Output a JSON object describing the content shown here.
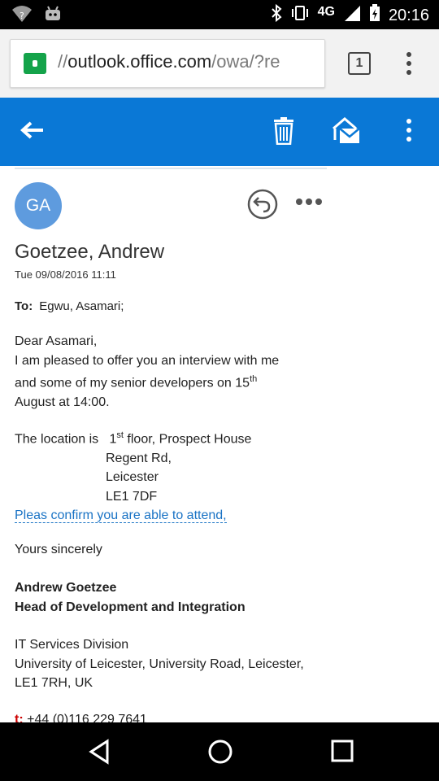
{
  "status_bar": {
    "network": "4G",
    "time": "20:16"
  },
  "browser": {
    "url_prefix": "//",
    "url_host": "outlook.office.com",
    "url_path": "/owa/?re",
    "tab_count": "1"
  },
  "email": {
    "avatar_initials": "GA",
    "sender": "Goetzee, Andrew",
    "date": "Tue 09/08/2016 11:11",
    "to_label": "To:",
    "to_value": "Egwu, Asamari;",
    "greeting": "Dear Asamari,",
    "para1_line1": "I am pleased to offer you an interview with me",
    "para1_line2_pre": "and some of my senior developers on 15",
    "para1_sup": "th",
    "para1_line3": "August at 14:00.",
    "loc_label": "The location is",
    "loc_num": "1",
    "loc_sup": "st",
    "loc_line1": " floor, Prospect House",
    "loc_line2": "Regent Rd,",
    "loc_line3": "Leicester",
    "loc_line4": "LE1 7DF",
    "confirm_link": "Pleas confirm you are able to attend,",
    "closing": "Yours sincerely",
    "sig_name": "Andrew Goetzee",
    "sig_title": "Head of Development and Integration",
    "dept": "IT Services Division",
    "address1": "University of Leicester,  University Road, Leicester,",
    "address2": "LE1 7RH, UK",
    "phone_label": "t:",
    "phone": " +44 (0)116 229 7641"
  }
}
